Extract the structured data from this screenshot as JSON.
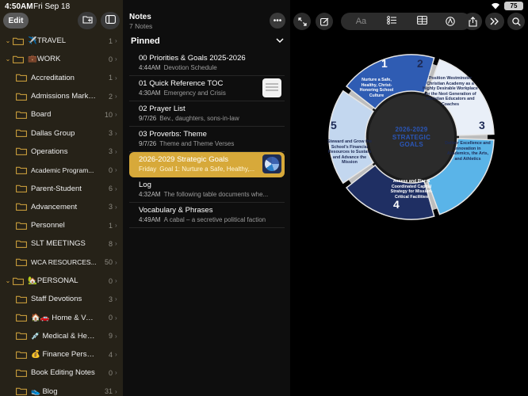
{
  "status": {
    "time": "4:50AM",
    "date": "Fri Sep 18",
    "battery": "75"
  },
  "sidebar": {
    "edit_label": "Edit",
    "folders": [
      {
        "name": "✈️TRAVEL",
        "count": "1",
        "level": 0,
        "chev": "⌄"
      },
      {
        "name": "💼WORK",
        "count": "0",
        "level": 0,
        "chev": "⌄"
      },
      {
        "name": "Accreditation",
        "count": "1",
        "level": 1
      },
      {
        "name": "Admissions Marketing",
        "count": "2",
        "level": 1
      },
      {
        "name": "Board",
        "count": "10",
        "level": 1
      },
      {
        "name": "Dallas Group",
        "count": "3",
        "level": 1
      },
      {
        "name": "Operations",
        "count": "3",
        "level": 1
      },
      {
        "name": "Academic Program...",
        "count": "0",
        "level": 1,
        "small": true
      },
      {
        "name": "Parent-Student",
        "count": "6",
        "level": 1
      },
      {
        "name": "Advancement",
        "count": "3",
        "level": 1
      },
      {
        "name": "Personnel",
        "count": "1",
        "level": 1
      },
      {
        "name": "SLT MEETINGS",
        "count": "8",
        "level": 1
      },
      {
        "name": "WCA RESOURCES...",
        "count": "50",
        "level": 1,
        "small": true
      },
      {
        "name": "🏡PERSONAL",
        "count": "0",
        "level": 0,
        "chev": "⌄"
      },
      {
        "name": "Staff Devotions",
        "count": "3",
        "level": 1
      },
      {
        "name": "🏠🚗 Home & Vehi...",
        "count": "0",
        "level": 1
      },
      {
        "name": "💉 Medical & Health",
        "count": "9",
        "level": 1
      },
      {
        "name": "💰 Finance Personal",
        "count": "4",
        "level": 1
      },
      {
        "name": "Book Editing Notes",
        "count": "0",
        "level": 1
      },
      {
        "name": "👟 Blog",
        "count": "31",
        "level": 1
      }
    ]
  },
  "notes_panel": {
    "title": "Notes",
    "subtitle": "7 Notes",
    "section": "Pinned",
    "notes": [
      {
        "title": "00 Priorities & Goals 2025-2026",
        "time": "4:44AM",
        "preview": "Devotion Schedule",
        "thumb": ""
      },
      {
        "title": "01 Quick Reference TOC",
        "time": "4:30AM",
        "preview": "Emergency and Crisis",
        "thumb": "white"
      },
      {
        "title": "02 Prayer List",
        "time": "9/7/26",
        "preview": "Bev., daughters, sons-in-law",
        "thumb": ""
      },
      {
        "title": "03 Proverbs: Theme",
        "time": "9/7/26",
        "preview": "Theme and Theme Verses",
        "thumb": ""
      },
      {
        "title": "2026-2029 Strategic Goals",
        "time": "Friday",
        "preview": "Goal 1: Nurture a Safe, Healthy,...",
        "thumb": "blue",
        "selected": true
      },
      {
        "title": "Log",
        "time": "4:32AM",
        "preview": "The following table documents whe...",
        "thumb": ""
      },
      {
        "title": "Vocabulary & Phrases",
        "time": "4:49AM",
        "preview": "A cabal – a secretive political faction",
        "thumb": ""
      }
    ]
  },
  "editor": {
    "format_label": "Aa",
    "graphic": {
      "center_title": "2026-2029 STRATEGIC GOALS",
      "goals": [
        {
          "num": "1",
          "text": "Nurture a Safe, Healthy, Christ-Honoring School Culture",
          "color": "#2f5cb3"
        },
        {
          "num": "2",
          "text": "Position Westminster Christian Academy as a Highly Desirable Workplace for the Next Generation of Christian Educators and Coaches",
          "color": "#e9eff8"
        },
        {
          "num": "3",
          "text": "Deliver Excellence and Innovation in Academics, the Arts, and Athletics",
          "color": "#5ab4e8"
        },
        {
          "num": "4",
          "text": "Assess and Plan a Coordinated Capital Strategy for Mission-Critical Facilities",
          "color": "#1f2f63"
        },
        {
          "num": "5",
          "text": "Steward and Grow the School's Financial Resources to Sustain and Advance the Mission",
          "color": "#c3d7ef"
        }
      ]
    }
  }
}
